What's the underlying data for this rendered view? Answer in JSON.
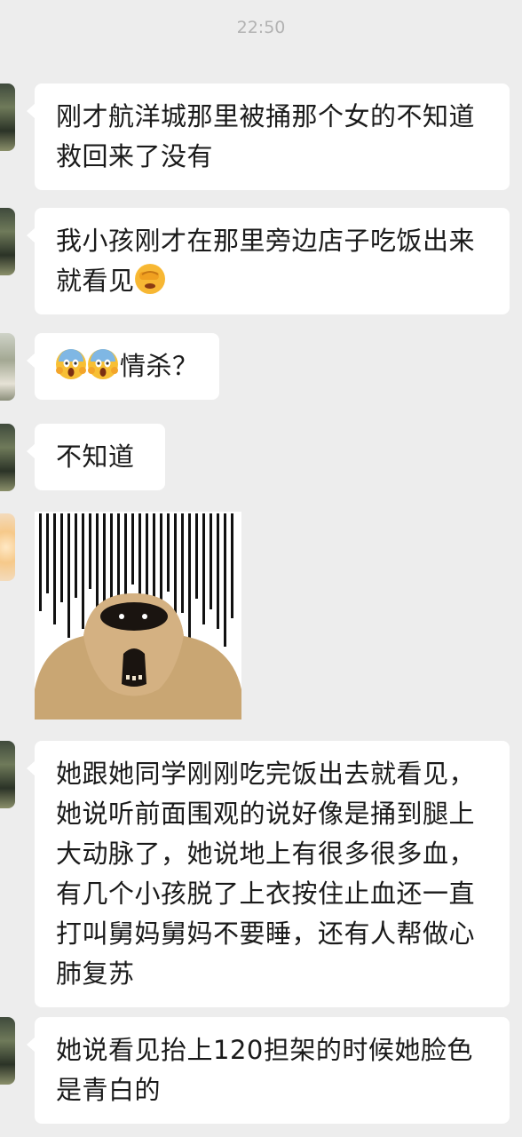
{
  "status": {
    "time": "22:50"
  },
  "messages": [
    {
      "text": "刚才航洋城那里被捅那个女的不知道救回来了没有"
    },
    {
      "text": "我小孩刚才在那里旁边店子吃饭出来就看见",
      "emoji": "face-palm-emoji"
    },
    {
      "emoji": "screaming-face-emoji",
      "text": "情杀？"
    },
    {
      "text": "不知道"
    },
    {
      "sticker": "sad-potato-monster-sticker"
    },
    {
      "text": "她跟她同学刚刚吃完饭出去就看见，她说听前面围观的说好像是捅到腿上大动脉了，她说地上有很多很多血，有几个小孩脱了上衣按住止血还一直打叫舅妈舅妈不要睡，还有人帮做心肺复苏"
    },
    {
      "text": "她说看见抬上120担架的时候她脸色是青白的"
    }
  ],
  "colors": {
    "background": "#ededed",
    "bubble": "#ffffff",
    "text": "#1a1a1a",
    "timestamp": "#b2b2b2"
  }
}
